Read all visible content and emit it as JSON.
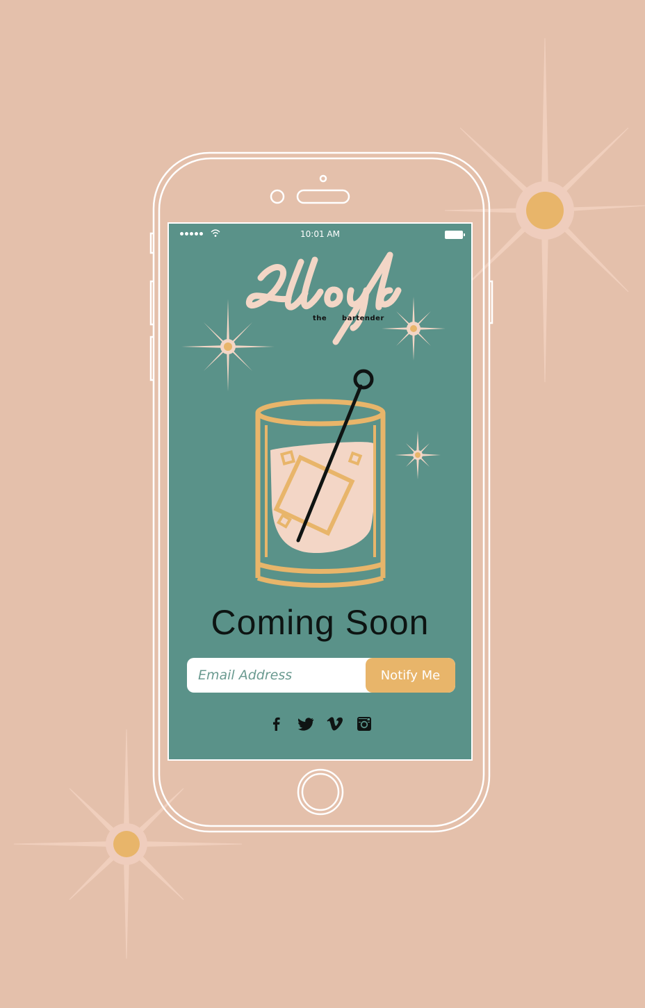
{
  "status_bar": {
    "time": "10:01 AM"
  },
  "brand": {
    "logo_text": "Lloyd",
    "tagline_left": "the",
    "tagline_right": "bartender"
  },
  "headline": "Coming Soon",
  "signup": {
    "email_placeholder": "Email Address",
    "button_label": "Notify Me"
  },
  "social": {
    "icons": [
      "facebook-icon",
      "twitter-icon",
      "vimeo-icon",
      "instagram-icon"
    ]
  },
  "colors": {
    "background": "#e4c0ab",
    "screen": "#5a9289",
    "accent": "#e8b56a",
    "cream": "#f3d6c6"
  }
}
